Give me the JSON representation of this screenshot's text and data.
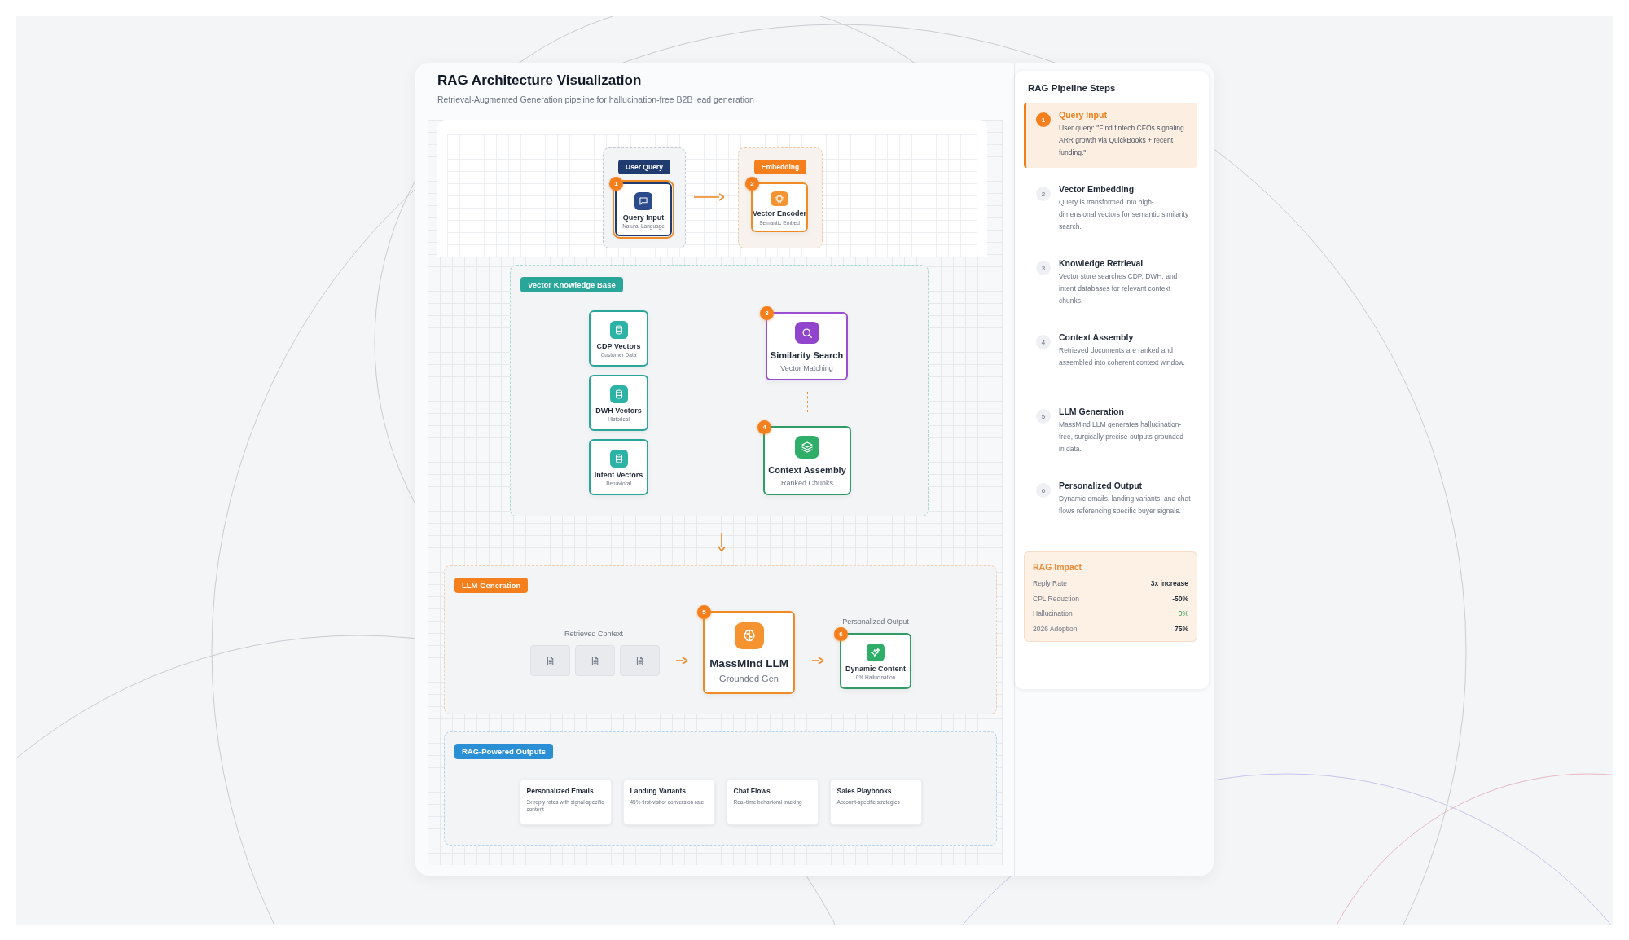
{
  "header": {
    "title": "RAG Architecture Visualization",
    "subtitle": "Retrieval-Augmented Generation pipeline for hallucination-free B2B lead generation"
  },
  "diagram": {
    "groups": [
      {
        "tag": "User Query",
        "color": "#1f3b6f",
        "nodes": [
          {
            "kind": "query",
            "step": "1",
            "title": "Query Input",
            "subtitle": "Natural Language",
            "active": true
          }
        ]
      },
      {
        "tag": "Embedding",
        "color": "#f47f1c",
        "nodes": [
          {
            "kind": "encoder",
            "step": "2",
            "title": "Vector Encoder",
            "subtitle": "Semantic Embed",
            "active": false
          }
        ]
      }
    ],
    "knowledge_base": {
      "tag": "Vector Knowledge Base",
      "color": "#2aa59a",
      "sources": [
        {
          "kind": "source",
          "title": "CDP Vectors",
          "subtitle": "Customer Data"
        },
        {
          "kind": "source",
          "title": "DWH Vectors",
          "subtitle": "Historical"
        },
        {
          "kind": "source",
          "title": "Intent Vectors",
          "subtitle": "Behavioral"
        }
      ],
      "nodes": [
        {
          "kind": "search",
          "step": "3",
          "title": "Similarity Search",
          "subtitle": "Vector Matching",
          "active": false
        },
        {
          "kind": "assembly",
          "step": "4",
          "title": "Context Assembly",
          "subtitle": "Ranked Chunks",
          "active": false
        }
      ]
    },
    "generation": {
      "tag": "LLM Generation",
      "color": "#f47f1c",
      "context_label": "Retrieved Context",
      "llm": {
        "kind": "llm",
        "step": "5",
        "title": "MassMind LLM",
        "subtitle": "Grounded Gen",
        "active": false
      },
      "output_label": "Personalized Output",
      "output": {
        "kind": "output",
        "step": "6",
        "title": "Dynamic Content",
        "subtitle": "0% Hallucination",
        "active": false
      }
    },
    "outputs": {
      "tag": "RAG-Powered Outputs",
      "color": "#2b8fd6",
      "cards": [
        {
          "title": "Personalized Emails",
          "description": "3x reply rates with signal-specific content"
        },
        {
          "title": "Landing Variants",
          "description": "45% first-visitor conversion rate"
        },
        {
          "title": "Chat Flows",
          "description": "Real-time behavioral tracking"
        },
        {
          "title": "Sales Playbooks",
          "description": "Account-specific strategies"
        }
      ]
    }
  },
  "pipeline": {
    "title": "RAG Pipeline Steps",
    "steps": [
      {
        "number": "1",
        "title": "Query Input",
        "description": "User query: \"Find fintech CFOs signaling ARR growth via QuickBooks + recent funding.\"",
        "selected": true
      },
      {
        "number": "2",
        "title": "Vector Embedding",
        "description": "Query is transformed into high-dimensional vectors for semantic similarity search.",
        "selected": false
      },
      {
        "number": "3",
        "title": "Knowledge Retrieval",
        "description": "Vector store searches CDP, DWH, and intent databases for relevant context chunks.",
        "selected": false
      },
      {
        "number": "4",
        "title": "Context Assembly",
        "description": "Retrieved documents are ranked and assembled into coherent context window.",
        "selected": false
      },
      {
        "number": "5",
        "title": "LLM Generation",
        "description": "MassMind LLM generates hallucination-free, surgically precise outputs grounded in data.",
        "selected": false
      },
      {
        "number": "6",
        "title": "Personalized Output",
        "description": "Dynamic emails, landing variants, and chat flows referencing specific buyer signals.",
        "selected": false
      }
    ]
  },
  "impact": {
    "title": "RAG Impact",
    "metrics": [
      {
        "label": "Reply Rate",
        "value": "3x increase",
        "kind": "plain"
      },
      {
        "label": "CPL Reduction",
        "value": "-50%",
        "kind": "plain"
      },
      {
        "label": "Hallucination",
        "value": "0%",
        "kind": "positive"
      },
      {
        "label": "2026 Adoption",
        "value": "75%",
        "kind": "plain"
      }
    ]
  }
}
